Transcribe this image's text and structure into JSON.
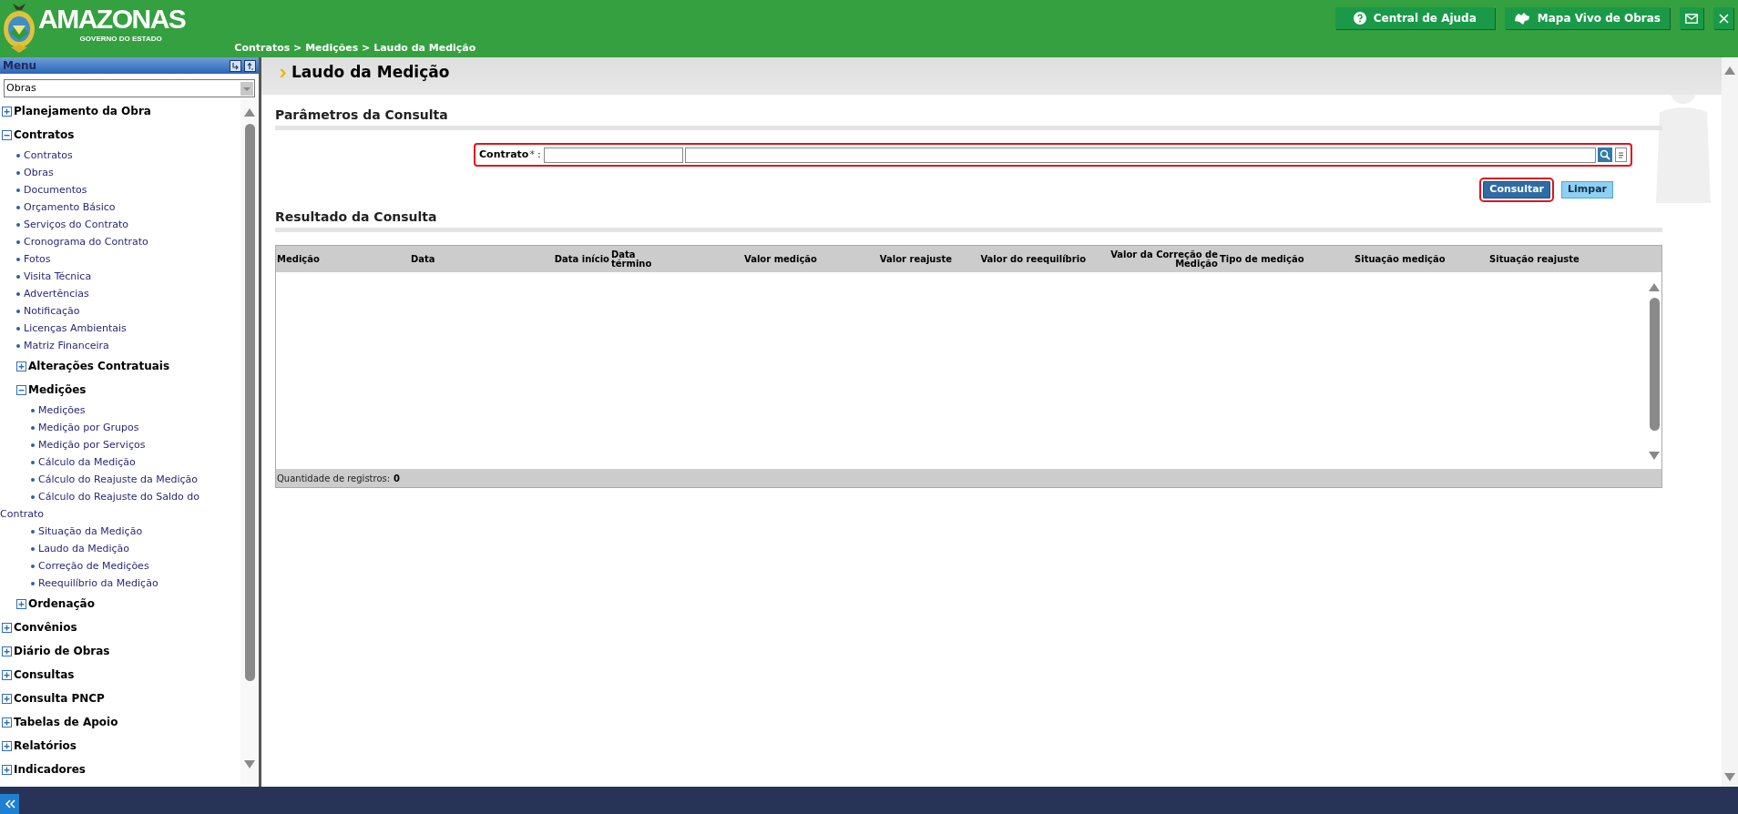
{
  "header": {
    "logo_title": "AMAZONAS",
    "logo_subtitle": "GOVERNO DO ESTADO",
    "breadcrumb": "Contratos > Medições > Laudo da Medição",
    "buttons": [
      {
        "kind": "help",
        "label": "Central de Ajuda"
      },
      {
        "kind": "map",
        "label": "Mapa Vivo de Obras"
      },
      {
        "kind": "mail"
      },
      {
        "kind": "close"
      }
    ]
  },
  "sidebar": {
    "title": "Menu",
    "module_select": {
      "value": "Obras"
    },
    "items": [
      {
        "kind": "group",
        "label": "Planejamento da Obra",
        "expanded": false
      },
      {
        "kind": "group",
        "label": "Contratos",
        "expanded": true,
        "children": [
          {
            "kind": "link",
            "label": "Contratos"
          },
          {
            "kind": "link",
            "label": "Obras"
          },
          {
            "kind": "link",
            "label": "Documentos"
          },
          {
            "kind": "link",
            "label": "Orçamento Básico"
          },
          {
            "kind": "link",
            "label": "Serviços do Contrato"
          },
          {
            "kind": "link",
            "label": "Cronograma do Contrato"
          },
          {
            "kind": "link",
            "label": "Fotos"
          },
          {
            "kind": "link",
            "label": "Visita Técnica"
          },
          {
            "kind": "link",
            "label": "Advertências"
          },
          {
            "kind": "link",
            "label": "Notificação"
          },
          {
            "kind": "link",
            "label": "Licenças Ambientais"
          },
          {
            "kind": "link",
            "label": "Matriz Financeira"
          },
          {
            "kind": "group",
            "label": "Alterações Contratuais",
            "expanded": false
          },
          {
            "kind": "group",
            "label": "Medições",
            "expanded": true,
            "children": [
              {
                "kind": "link",
                "label": "Medições"
              },
              {
                "kind": "link",
                "label": "Medição por Grupos"
              },
              {
                "kind": "link",
                "label": "Medição por Serviços"
              },
              {
                "kind": "link",
                "label": "Cálculo da Medição"
              },
              {
                "kind": "link",
                "label": "Cálculo do Reajuste da Medição"
              },
              {
                "kind": "link",
                "label": "Cálculo do Reajuste do Saldo do Contrato"
              },
              {
                "kind": "link",
                "label": "Situação da Medição"
              },
              {
                "kind": "link",
                "label": "Laudo da Medição"
              },
              {
                "kind": "link",
                "label": "Correção de Medições"
              },
              {
                "kind": "link",
                "label": "Reequilíbrio da Medição"
              }
            ]
          },
          {
            "kind": "group",
            "label": "Ordenação",
            "expanded": false
          }
        ]
      },
      {
        "kind": "group",
        "label": "Convênios",
        "expanded": false
      },
      {
        "kind": "group",
        "label": "Diário de Obras",
        "expanded": false
      },
      {
        "kind": "group",
        "label": "Consultas",
        "expanded": false
      },
      {
        "kind": "group",
        "label": "Consulta PNCP",
        "expanded": false
      },
      {
        "kind": "group",
        "label": "Tabelas de Apoio",
        "expanded": false
      },
      {
        "kind": "group",
        "label": "Relatórios",
        "expanded": false
      },
      {
        "kind": "group",
        "label": "Indicadores",
        "expanded": false
      }
    ]
  },
  "page": {
    "title": "Laudo da Medição",
    "parameters": {
      "heading": "Parâmetros da Consulta",
      "field": {
        "label": "Contrato",
        "required_mark": "*",
        "separator": ":",
        "highlighted": true
      },
      "buttons": [
        {
          "kind": "primary",
          "label": "Consultar",
          "highlighted": true
        },
        {
          "kind": "secondary",
          "label": "Limpar",
          "highlighted": false
        }
      ]
    },
    "results": {
      "heading": "Resultado da Consulta",
      "columns": [
        "Medição",
        "Data",
        "Data início",
        "Data término",
        "Valor medição",
        "Valor reajuste",
        "Valor do reequilíbrio",
        "Valor da Correção de Medição",
        "Tipo de medição",
        "Situação medição",
        "Situação reajuste"
      ],
      "footer_label": "Quantidade de registros:",
      "count": "0"
    }
  }
}
